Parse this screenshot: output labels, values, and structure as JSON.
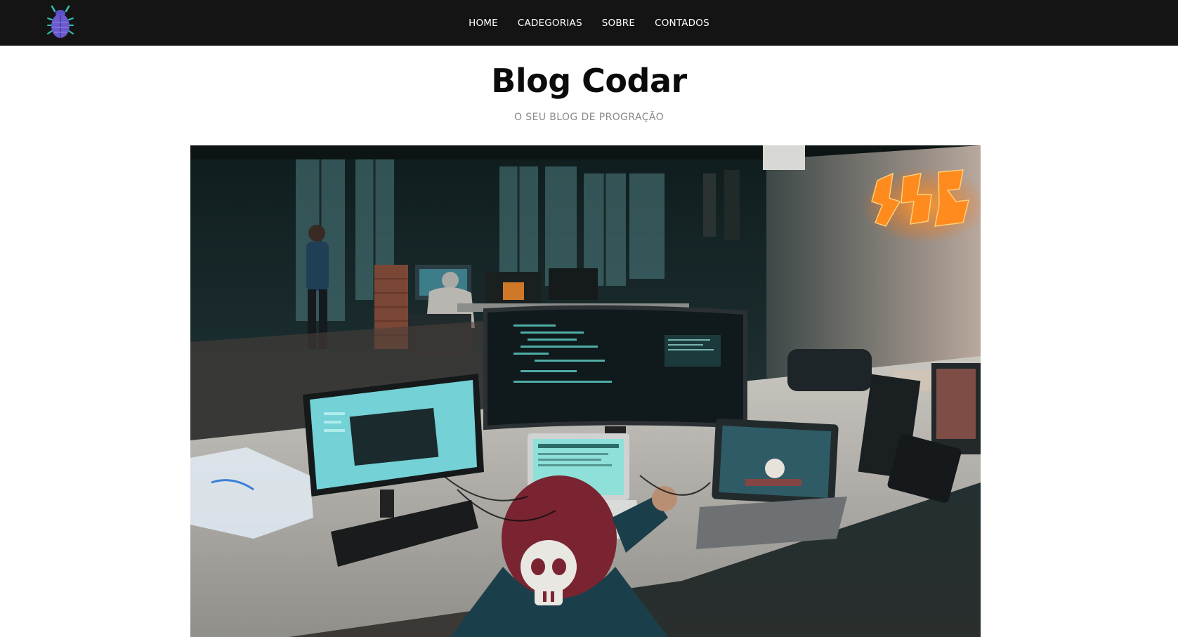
{
  "header": {
    "logo_icon": "bug-icon",
    "nav": [
      {
        "label": "HOME"
      },
      {
        "label": "CADEGORIAS"
      },
      {
        "label": "SOBRE"
      },
      {
        "label": "CONTADOS"
      }
    ]
  },
  "main": {
    "title": "Blog Codar",
    "subtitle": "O SEU BLOG DE PROGRAÇÃO",
    "hero_image": {
      "icon": "workspace-photo",
      "sign_color": "#ff8a1e",
      "screen_color": "#74d1d6"
    }
  },
  "colors": {
    "navbar": "#141414",
    "logo": "#6a5acd",
    "logo_accent": "#2ec4b6"
  }
}
